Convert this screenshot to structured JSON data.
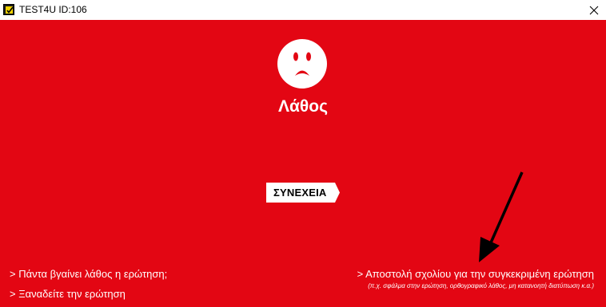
{
  "window": {
    "title": "TEST4U ID:106",
    "app_icon": "test4u-check-icon",
    "close_icon": "close-icon"
  },
  "colors": {
    "background": "#e30613",
    "foreground": "#ffffff",
    "arrow": "#000000"
  },
  "result": {
    "face_icon": "sad-face-icon",
    "heading": "Λάθος"
  },
  "continue_button": {
    "label": "ΣΥΝΕΧΕΙΑ"
  },
  "links": {
    "always_wrong": "> Πάντα βγαίνει λάθος η ερώτηση;",
    "reread": "> Ξαναδείτε την ερώτηση",
    "comment": "> Αποστολή σχολίου για την συγκεκριμένη ερώτηση",
    "comment_note": "(π.χ. σφάλμα στην ερώτηση, ορθογραφικό λάθος, μη κατανοητή διατύπωση κ.α.)"
  },
  "annotation": {
    "icon": "arrow-pointer-icon"
  }
}
